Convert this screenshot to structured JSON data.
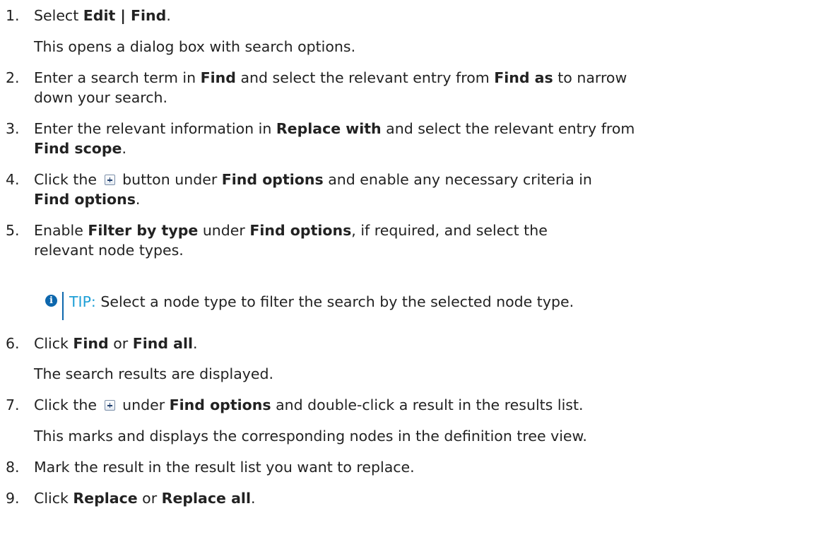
{
  "steps": [
    {
      "number": "1.",
      "pre": "Select ",
      "bold": "Edit | Find",
      "post": ".",
      "note": "This opens a dialog box with search options."
    },
    {
      "number": "2.",
      "line1": {
        "a": "Enter a search term in ",
        "b1": "Find",
        "c": " and select the relevant entry from ",
        "b2": "Find as",
        "d": " to narrow"
      },
      "line2": "down your search."
    },
    {
      "number": "3.",
      "line1": {
        "a": "Enter the relevant information in ",
        "b1": "Replace with",
        "c": " and select the relevant entry from"
      },
      "line2": {
        "b": "Find scope",
        "post": "."
      }
    },
    {
      "number": "4.",
      "line1": {
        "a": "Click the",
        "c": "button under ",
        "b1": "Find options",
        "d": " and enable any necessary criteria in"
      },
      "line2": {
        "b": "Find options",
        "post": "."
      }
    },
    {
      "number": "5.",
      "line1": {
        "a": "Enable ",
        "b1": "Filter by type",
        "c": " under ",
        "b2": "Find options",
        "d": ", if required, and select the"
      },
      "line2": "relevant node types."
    },
    {
      "number": "6.",
      "line1": {
        "a": "Click ",
        "b1": "Find",
        "c": " or ",
        "b2": "Find all",
        "d": "."
      },
      "note": "The search results are displayed."
    },
    {
      "number": "7.",
      "line1": {
        "a": "Click the",
        "c": "under ",
        "b1": "Find options",
        "d": " and double-click a result in the results list."
      },
      "note": "This marks and displays the corresponding nodes in the definition tree view."
    },
    {
      "number": "8.",
      "text": "Mark the result in the result list you want to replace."
    },
    {
      "number": "9.",
      "line1": {
        "a": "Click ",
        "b1": "Replace",
        "c": " or ",
        "b2": "Replace all",
        "d": "."
      }
    }
  ],
  "tip": {
    "icon": "info-icon",
    "label": "TIP:",
    "text": " Select a node type to filter the search by the selected node type."
  },
  "colors": {
    "tip_label": "#1e9fd6",
    "tip_bar": "#0d67ad",
    "text": "#222222"
  }
}
